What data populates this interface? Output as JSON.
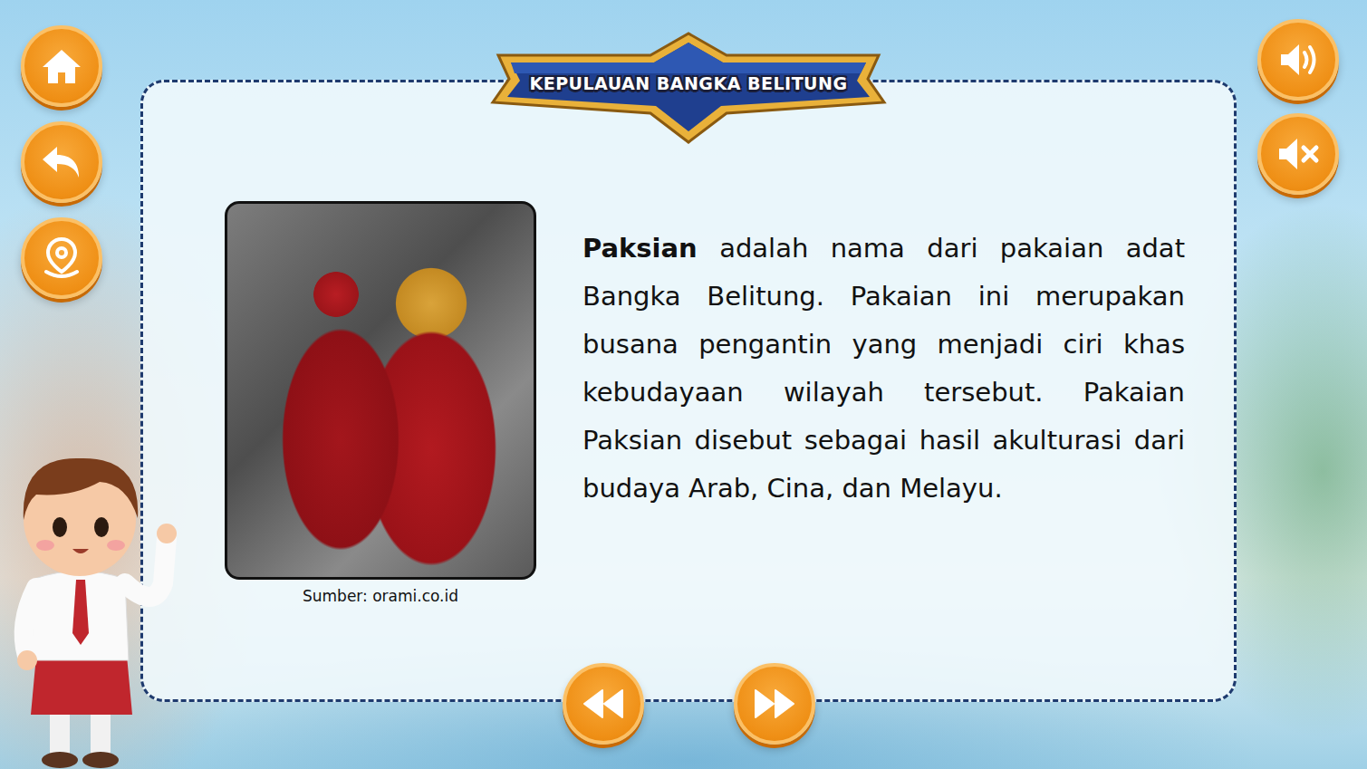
{
  "header": {
    "title": "KEPULAUAN BANGKA BELITUNG"
  },
  "article": {
    "paragraph": [
      {
        "text": "Paksian",
        "bold": true
      },
      {
        "text": " adalah nama dari pakaian adat Bangka Belitung. Pakaian ini merupakan busana pengantin yang menjadi ciri khas kebudayaan wilayah tersebut. Pakaian Paksian disebut sebagai hasil akulturasi dari budaya Arab, Cina, dan Melayu.",
        "bold": false
      }
    ],
    "image_caption": "Sumber: orami.co.id"
  }
}
